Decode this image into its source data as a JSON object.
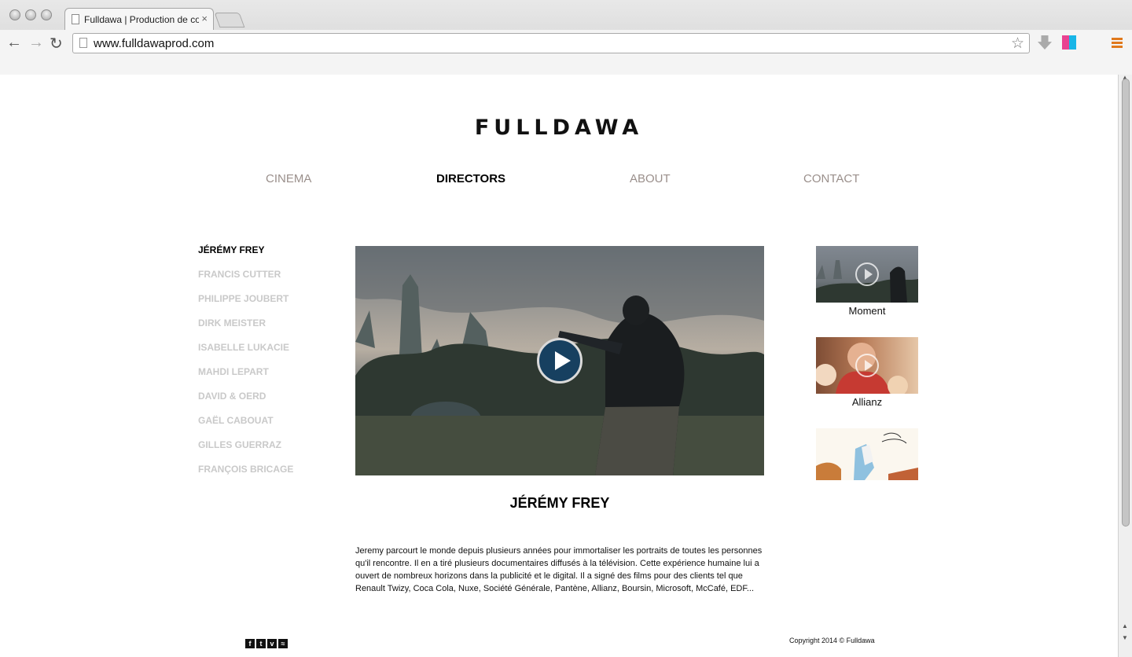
{
  "browser": {
    "tab_title": "Fulldawa | Production de contenus",
    "tab_close": "×",
    "url": "www.fulldawaprod.com",
    "back": "←",
    "forward": "→",
    "reload": "↻",
    "star": "☆"
  },
  "site": {
    "logo": "FULLDAWA",
    "nav": [
      "CINEMA",
      "DIRECTORS",
      "ABOUT",
      "CONTACT"
    ],
    "directors": [
      "JÉRÉMY FREY",
      "FRANCIS CUTTER",
      "PHILIPPE JOUBERT",
      "DIRK MEISTER",
      "ISABELLE LUKACIE",
      "MAHDI LEPART",
      "DAVID & OERD",
      "GAËL CABOUAT",
      "GILLES GUERRAZ",
      "FRANÇOIS BRICAGE"
    ],
    "featured_title": "JÉRÉMY FREY",
    "bio": "Jeremy parcourt le monde depuis plusieurs années pour immortaliser les portraits de toutes les personnes qu'il rencontre. Il en a tiré plusieurs documentaires diffusés à la télévision. Cette expérience humaine lui a ouvert de nombreux horizons dans la publicité et le digital. Il a signé des films pour des clients tel que Renault Twizy, Coca Cola, Nuxe, Société Générale, Pantène, Allianz, Boursin, Microsoft, McCafé, EDF...",
    "thumbnails": [
      "Moment",
      "Allianz"
    ],
    "copyright": "Copyright 2014 © Fulldawa"
  }
}
